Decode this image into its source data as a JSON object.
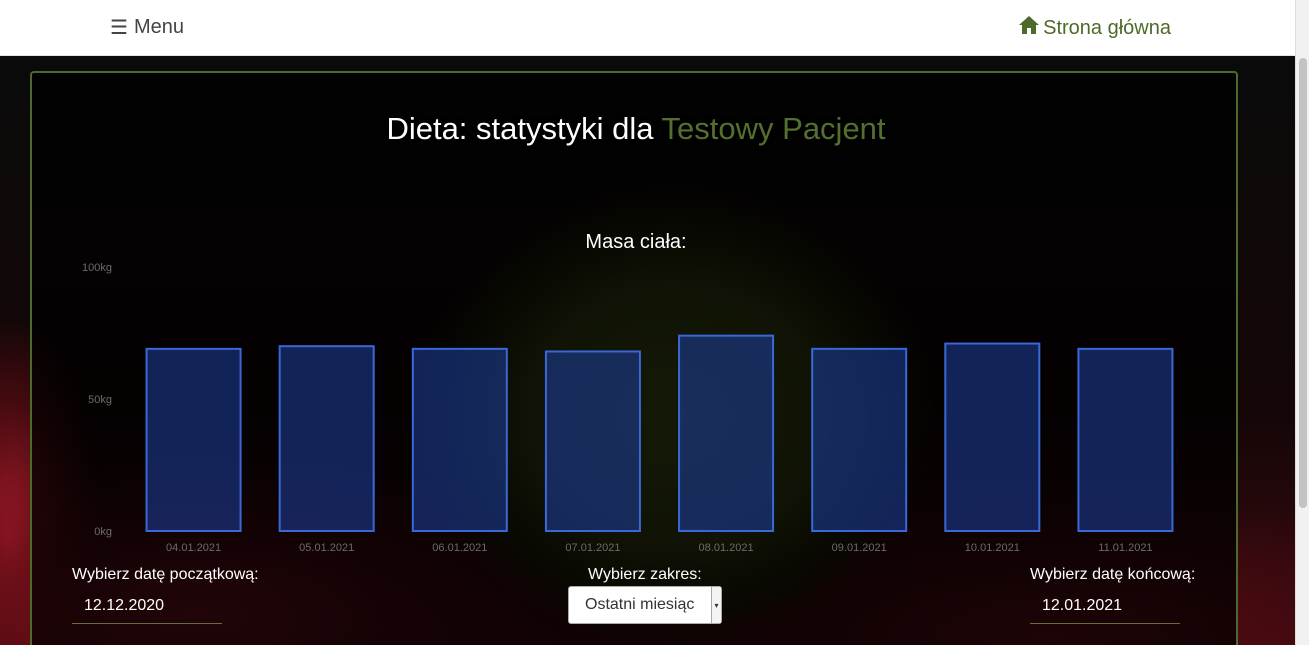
{
  "nav": {
    "menu_label": "Menu",
    "home_label": "Strona główna"
  },
  "page": {
    "title_prefix": "Dieta: statystyki dla",
    "patient_name": "Testowy Pacjent"
  },
  "chart_title": "Masa ciała:",
  "chart_data": {
    "type": "bar",
    "title": "Masa ciała:",
    "categories": [
      "04.01.2021",
      "05.01.2021",
      "06.01.2021",
      "07.01.2021",
      "08.01.2021",
      "09.01.2021",
      "10.01.2021",
      "11.01.2021"
    ],
    "values": [
      69,
      70,
      69,
      68,
      74,
      69,
      71,
      69
    ],
    "yticks": [
      "0kg",
      "50kg",
      "100kg"
    ],
    "ylim": [
      0,
      100
    ],
    "grid": false
  },
  "controls": {
    "start_label": "Wybierz datę początkową:",
    "start_value": "12.12.2020",
    "range_label": "Wybierz zakres:",
    "range_value": "Ostatni miesiąc",
    "end_label": "Wybierz datę końcową:",
    "end_value": "12.01.2021"
  },
  "colors": {
    "accent": "#4e6a2a",
    "bar_fill": "#1e40a0",
    "bar_stroke": "#3a68d8"
  }
}
